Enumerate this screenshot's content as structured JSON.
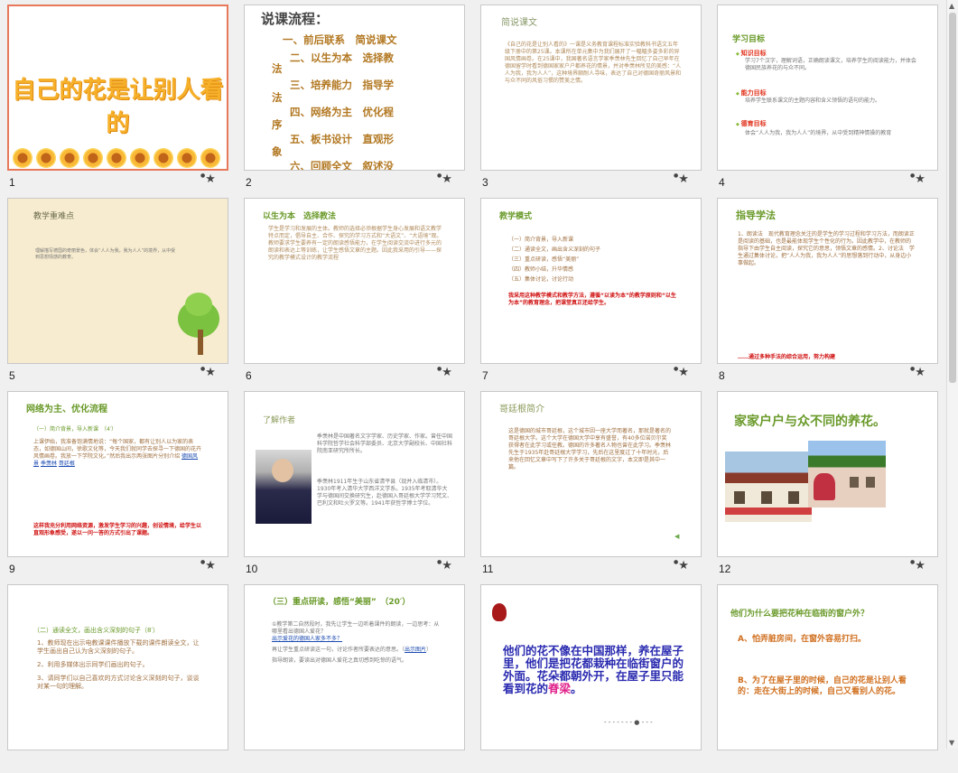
{
  "slides": [
    {
      "number": "1",
      "title": "自己的花是让别人看的"
    },
    {
      "number": "2",
      "title": "说课流程：",
      "items": [
        "一、前后联系　简说课文",
        "二、以生为本　选择教",
        "三、培养能力　指导学",
        "四、网络为主　优化程",
        "五、板书设计　直观形",
        "六、回顾全文　叙述没"
      ],
      "side": [
        "法",
        "法",
        "序",
        "象"
      ]
    },
    {
      "number": "3",
      "heading": "简说课文",
      "body": "《自己的花是让别人看的》一课是义务教育课程标准实验教科书语文五年级下册中的第25课。本课所在单元集中为我们展开了一幅幅多姿多彩的异国风情画卷。在25课中，我国著名语言学家季羡林先生回忆了自己早年在德国留学时看到德国家家户户都养花的情景，并对季羡林所见的美感：“人人为我，我为人人”，这种境界颇耐人寻味，表达了自己对德国奇丽风景和与众不同的风俗习惯的赞美之情。"
    },
    {
      "number": "4",
      "heading": "学习目标",
      "sections": [
        {
          "label": "知识目标",
          "text": "学习7个汉字，理解词语，正确朗读课文，培养学生的阅读能力，并体会德国民族养花的与众不同。"
        },
        {
          "label": "能力目标",
          "text": "培养学生联系课文的主题内容和含义领悟的语句的能力。"
        },
        {
          "label": "德育目标",
          "text": "体会“人人为我，我为人人”的境界，从中受到精神情操的教育"
        }
      ]
    },
    {
      "number": "5",
      "heading": "教学重难点",
      "body": "理解描写德国的奇丽景色，体会“人人为我，我为人人”的境界，从中受到思想情感的教育。"
    },
    {
      "number": "6",
      "heading": "以生为本　选择教法",
      "body": "学生是学习和发展的主体。教师的选择必须根据学生身心发展和语文教学特点而定，倡导自主、合作、探究的学习方式和“大语文”、“大语境”观。教师要求学生要养有一定的朗读感悟能力，在学生阅读交流中进行多元的朗读和表达上等训练，让学生感悟文章的主题。因此我采用的引导——探究的教学模式设计的教学流程"
    },
    {
      "number": "7",
      "heading": "教学模式",
      "steps": [
        "（一）简介背景，导入新课",
        "（二）通读全文，画出含义深刻的句子",
        "（三）重点研读，感悟“美丽”",
        "（四）教师小结，升华情感",
        "（五）集体讨论，讨论行动"
      ],
      "note": "我采用这种教学模式和教学方法，遵循“以读为本”的教学原则和“以生为本”的教育理念，把课堂真正还给学生。"
    },
    {
      "number": "8",
      "heading": "指导学法",
      "body": "1、朗读法　现代教育理念关注的是学生的学习过程和学习方法，而朗读正是阅读的基础，也是最能体现学生个性化的行为。因此教学中，在教师的指导下由学生自主阅读，探究它的意思，领悟文章的感情。2、讨论法　学生通过集体讨论，把“人人为我，我为人人”的思想落到行动中，从身边小事做起。",
      "note": "……通过多种手法的综合运用，努力构建"
    },
    {
      "number": "9",
      "heading": "网络为主、优化流程",
      "sub": "（一）简介背景，导入新课　（4′）",
      "body": "上课伊始，我准备饱满情地说：“每个国家，都有让别人以为家的表态，如德国山间，徐歌文化等，今天我们就同学去探寻一下德国的花卉风情画卷。我放一下学院文化。”然后我出示两张图片分别介绍",
      "links": [
        "德国风景",
        "季羡林",
        "哥廷根"
      ],
      "note": "这样我充分利用网络资源，激发学生学习的兴趣，创设情境，给学生以直观形象感受，遂以一问一答的方式引出了课题。"
    },
    {
      "number": "10",
      "heading": "了解作者",
      "p1": "季羡林是中国著名文字学家、历史学家、作家。曾任中国科学院哲学社会科学部委员、北京大学副校长、中国社科院南亚研究所所长。",
      "p2": "季羡林1911年生于山东省清平县（现并入临清市）。1930年考入清华大学西洋文学系。1935年考取清华大学与德国间交换研究生，赴德国入哥廷根大学学习梵文、巴利文和吐火罗文等。1941年获哲学博士学位。"
    },
    {
      "number": "11",
      "heading": "哥廷根简介",
      "body": "这是德国的城市哥廷根，这个城市因一座大学而著名，那就是著名的哥廷根大学。这个大学在德国大学中享有盛誉，有40多位诺贝尔奖获得者在此学习或任教。德国的许多著名人物也曾在此学习。季羡林先生于1935年赴哥廷根大学学习，先后在这里度过了十年时光，后来他在回忆文章中写下了许多关于哥廷根的文字，本文即是其中一篇。"
    },
    {
      "number": "12",
      "heading": "家家户户与众不同的养花。"
    },
    {
      "number": "13",
      "heading": "（二）通读全文，画出含义深刻的句子（8′）",
      "items": [
        "1、教师现在出示电教课课件播放下载的课件朗读全文，让学生画出自己认为含义深刻的句子。",
        "2、利用多媒体出示同学们画出的句子。",
        "3、请同学们以自己喜欢的方式讨论含义深刻的句子，谈谈对某一句的理解。"
      ]
    },
    {
      "number": "14",
      "heading": "（三）重点研读，感悟“美丽”　（20′）",
      "p1": "①教学第二自然段时，我先让学生一边听着课件的朗读，一边思考：从哪里看出德国人爱花？",
      "link1": "出示爱花的德国人家多不多？",
      "p2": "再让学生重点研读这一句，讨论作者所要表达的意思。（",
      "link2": "出示图片",
      "p3": "指导朗读，要读出对德国人爱花之真切感到吃惊的语气。"
    },
    {
      "number": "15",
      "body_a": "他们的花不像在中国那样，养在屋子里，他们是把花都栽种在临街窗户的外面。花朵都朝外开，在屋子里只能看到花的",
      "body_b": "脊梁",
      "body_c": "。",
      "footer": "- - - - - - - ● - - -"
    },
    {
      "number": "16",
      "heading": "他们为什么要把花种在临街的窗户外？",
      "options": [
        "A、怕弄脏房间，在窗外容易打扫。",
        "B、为了在屋子里的时候，自己的花是让别人看的：走在大街上的时候，自己又看别人的花。"
      ]
    }
  ],
  "star_icon_label": "★",
  "colors": {
    "accent": "#e8785a",
    "title_green": "#6a9a2a",
    "title_gold": "#f6b02a"
  }
}
